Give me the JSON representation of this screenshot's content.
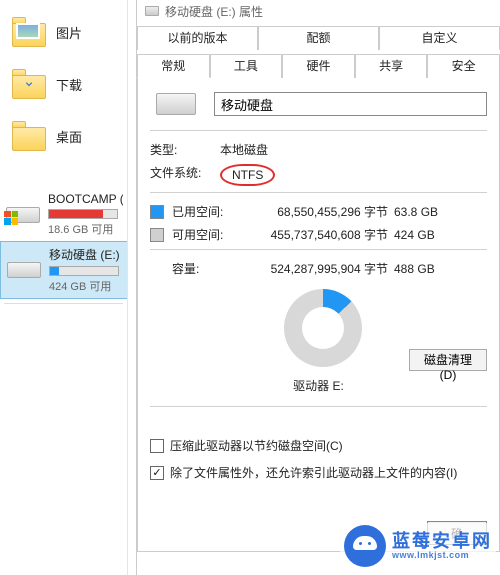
{
  "nav": {
    "items": [
      {
        "label": "图片"
      },
      {
        "label": "下载"
      },
      {
        "label": "桌面"
      }
    ],
    "drives": [
      {
        "name": "BOOTCAMP (",
        "free_text": "18.6 GB 可用",
        "bar_fill_pct": 80,
        "bar_color": "#e53935",
        "win_overlay": true
      },
      {
        "name": "移动硬盘 (E:)",
        "free_text": "424 GB 可用",
        "bar_fill_pct": 13,
        "bar_color": "#2196f3",
        "win_overlay": false
      }
    ]
  },
  "dialog": {
    "title": "移动硬盘 (E:) 属性",
    "tabs_top": [
      "以前的版本",
      "配额",
      "自定义"
    ],
    "tabs_bottom": [
      "常规",
      "工具",
      "硬件",
      "共享",
      "安全"
    ],
    "active_tab": "常规",
    "volume_name": "移动硬盘",
    "type_label": "类型:",
    "type_value": "本地磁盘",
    "fs_label": "文件系统:",
    "fs_value": "NTFS",
    "used_label": "已用空间:",
    "used_bytes": "68,550,455,296 字节",
    "used_human": "63.8 GB",
    "free_label": "可用空间:",
    "free_bytes": "455,737,540,608 字节",
    "free_human": "424 GB",
    "capacity_label": "容量:",
    "capacity_bytes": "524,287,995,904 字节",
    "capacity_human": "488 GB",
    "drive_letter_label": "驱动器 E:",
    "cleanup_button": "磁盘清理(D)",
    "check_compress": "压缩此驱动器以节约磁盘空间(C)",
    "check_index": "除了文件属性外，还允许索引此驱动器上文件的内容(I)",
    "ok_button": "确"
  },
  "watermark": {
    "line1": "蓝莓安卓网",
    "line2": "www.lmkjst.com"
  },
  "colors": {
    "accent": "#2196f3",
    "danger": "#e53935",
    "brand": "#2f6fdc"
  }
}
